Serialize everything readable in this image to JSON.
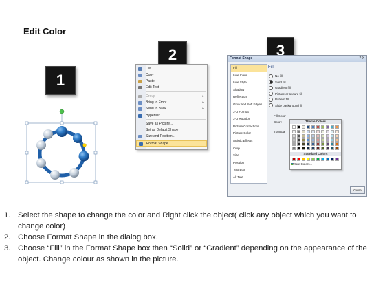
{
  "title": "Edit Color",
  "steps": [
    "1",
    "2",
    "3"
  ],
  "context_menu": {
    "items": [
      {
        "label": "Cut",
        "underline": "t",
        "icon": "scissors-icon",
        "color": "#5a7fb4",
        "disabled": false,
        "submenu": false
      },
      {
        "label": "Copy",
        "icon": "copy-icon",
        "color": "#6d8fc4",
        "disabled": false,
        "submenu": false
      },
      {
        "label": "Paste",
        "icon": "paste-icon",
        "color": "#c9a046",
        "disabled": false,
        "submenu": false
      },
      {
        "label": "Edit Text",
        "icon": "edit-text-icon",
        "color": "#777777",
        "disabled": false,
        "submenu": false
      },
      {
        "label": "Group",
        "icon": "group-icon",
        "color": "#aaaaaa",
        "disabled": true,
        "submenu": true
      },
      {
        "label": "Bring to Front",
        "icon": "bring-front-icon",
        "color": "#6d8fc4",
        "disabled": false,
        "submenu": true
      },
      {
        "label": "Send to Back",
        "icon": "send-back-icon",
        "color": "#6d8fc4",
        "disabled": false,
        "submenu": true
      },
      {
        "label": "Hyperlink...",
        "icon": "hyperlink-icon",
        "color": "#3a6db0",
        "disabled": false,
        "submenu": false
      },
      {
        "label": "Save as Picture...",
        "icon": "",
        "color": "",
        "disabled": false,
        "submenu": false
      },
      {
        "label": "Set as Default Shape",
        "icon": "",
        "color": "",
        "disabled": false,
        "submenu": false
      },
      {
        "label": "Size and Position...",
        "icon": "size-position-icon",
        "color": "#6d8fc4",
        "disabled": false,
        "submenu": false
      },
      {
        "label": "Format Shape...",
        "icon": "format-shape-icon",
        "color": "#3a6db0",
        "disabled": false,
        "submenu": false,
        "highlighted": true
      }
    ]
  },
  "dialog": {
    "title": "Format Shape",
    "title_buttons": "? X",
    "nav_items": [
      "Fill",
      "Line Color",
      "Line Style",
      "Shadow",
      "Reflection",
      "Glow and Soft Edges",
      "3-D Format",
      "3-D Rotation",
      "Picture Corrections",
      "Picture Color",
      "Artistic Effects",
      "Crop",
      "Size",
      "Position",
      "Text Box",
      "Alt Text"
    ],
    "selected_nav": "Fill",
    "fill_heading": "Fill",
    "fill_options": [
      "No fill",
      "Solid fill",
      "Gradient fill",
      "Picture or texture fill",
      "Pattern fill",
      "Slide background fill"
    ],
    "selected_fill": "Solid fill",
    "fill_color_label": "Fill Color",
    "color_label": "Color:",
    "transparency_label": "Transpa",
    "close_label": "Close"
  },
  "palette": {
    "theme_heading": "Theme Colors",
    "standard_heading": "Standard Colors",
    "more_colors": "More Colors...",
    "theme_top": [
      "#ffffff",
      "#000000",
      "#eeece1",
      "#1f497d",
      "#4f81bd",
      "#c0504d",
      "#9bbb59",
      "#8064a2",
      "#4bacc6",
      "#f79646"
    ],
    "theme_shades": [
      [
        "#f2f2f2",
        "#7f7f7f",
        "#ddd9c3",
        "#c6d9f0",
        "#dbe5f1",
        "#f2dcdb",
        "#ebf1dd",
        "#e5e0ec",
        "#dbeef3",
        "#fdeada"
      ],
      [
        "#d8d8d8",
        "#595959",
        "#c4bd97",
        "#8db3e2",
        "#b8cce4",
        "#e5b9b7",
        "#d7e3bc",
        "#ccc1d9",
        "#b7dde8",
        "#fbd5b5"
      ],
      [
        "#bfbfbf",
        "#3f3f3f",
        "#938953",
        "#548dd4",
        "#95b3d7",
        "#d99694",
        "#c3d69b",
        "#b2a2c7",
        "#92cddc",
        "#fac08f"
      ],
      [
        "#a5a5a5",
        "#262626",
        "#494429",
        "#17365d",
        "#366092",
        "#953734",
        "#76923c",
        "#5f497a",
        "#31859b",
        "#e36c09"
      ],
      [
        "#7f7f7f",
        "#0c0c0c",
        "#1d1b10",
        "#0f243e",
        "#244061",
        "#632423",
        "#4f6128",
        "#3f3151",
        "#205867",
        "#974806"
      ]
    ],
    "standard": [
      "#c00000",
      "#ff0000",
      "#ffc000",
      "#ffff00",
      "#92d050",
      "#00b050",
      "#00b0f0",
      "#0070c0",
      "#002060",
      "#7030a0"
    ]
  },
  "instructions": [
    {
      "num": "1.",
      "text": "Select the shape to change the color and Right click the object( click any object which you want to change color)"
    },
    {
      "num": "2.",
      "text": "Choose Format Shape in the dialog box."
    },
    {
      "num": "3.",
      "text": "Choose “Fill” in the Format Shape box then “Solid” or “Gradient” depending on the appearance of the object. Change colour as shown in the picture."
    }
  ]
}
